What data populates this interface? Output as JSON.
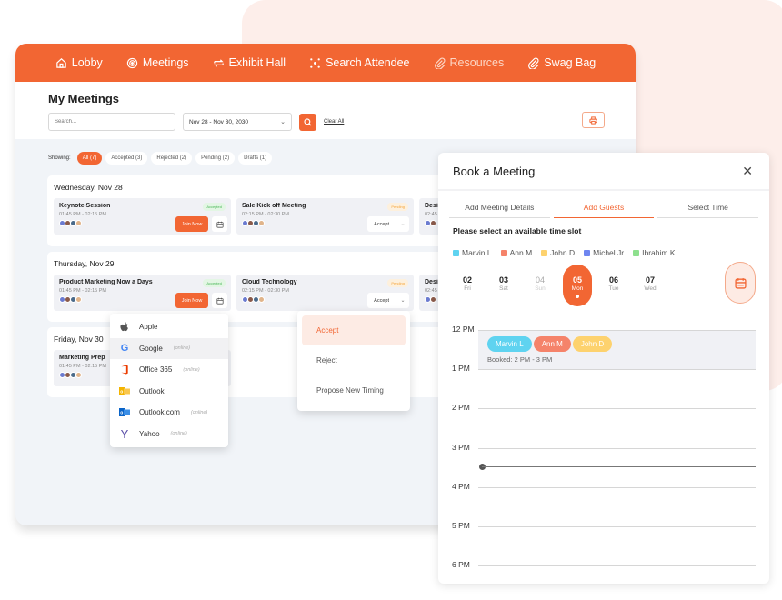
{
  "nav": {
    "items": [
      {
        "label": "Lobby",
        "icon": "home-icon"
      },
      {
        "label": "Meetings",
        "icon": "meetings-icon"
      },
      {
        "label": "Exhibit Hall",
        "icon": "exchange-icon"
      },
      {
        "label": "Search Attendee",
        "icon": "network-icon"
      },
      {
        "label": "Resources",
        "icon": "paperclip-icon"
      },
      {
        "label": "Swag Bag",
        "icon": "paperclip-icon"
      }
    ]
  },
  "meetings": {
    "title": "My Meetings",
    "search_placeholder": "Search...",
    "date_range": "Nov 28 - Nov 30, 2030",
    "clear_all": "Clear All",
    "showing_label": "Showing:",
    "filters": [
      {
        "label": "All (7)",
        "active": true
      },
      {
        "label": "Accepted (3)"
      },
      {
        "label": "Rejected (2)"
      },
      {
        "label": "Pending (2)"
      },
      {
        "label": "Drafts (1)"
      }
    ],
    "days": [
      {
        "title": "Wednesday, Nov 28",
        "cards": [
          {
            "title": "Keynote Session",
            "time": "01:45 PM - 02:15 PM",
            "status": "Accepted",
            "action": "Join Now"
          },
          {
            "title": "Sale Kick off Meeting",
            "time": "02:15 PM - 02:30 PM",
            "status": "Pending",
            "action": "Accept"
          },
          {
            "title": "Desi",
            "time": "02:45"
          }
        ]
      },
      {
        "title": "Thursday, Nov 29",
        "cards": [
          {
            "title": "Product Marketing Now a Days",
            "time": "01:45 PM - 02:15 PM",
            "status": "Accepted",
            "action": "Join Now"
          },
          {
            "title": "Cloud Technology",
            "time": "02:15 PM - 02:30 PM",
            "status": "Pending",
            "action": "Accept"
          },
          {
            "title": "Desi",
            "time": "02:45"
          }
        ]
      },
      {
        "title": "Friday, Nov 30",
        "cards": [
          {
            "title": "Marketing Prep",
            "time": "01:45 PM - 02:15 PM"
          }
        ]
      }
    ]
  },
  "calendar_menu": {
    "items": [
      {
        "label": "Apple",
        "note": ""
      },
      {
        "label": "Google",
        "note": "(online)"
      },
      {
        "label": "Office 365",
        "note": "(online)"
      },
      {
        "label": "Outlook",
        "note": ""
      },
      {
        "label": "Outlook.com",
        "note": "(online)"
      },
      {
        "label": "Yahoo",
        "note": "(online)"
      }
    ]
  },
  "accept_menu": {
    "items": [
      "Accept",
      "Reject",
      "Propose New Timing"
    ]
  },
  "book": {
    "title": "Book a Meeting",
    "tabs": [
      "Add Meeting Details",
      "Add Guests",
      "Select Time"
    ],
    "active_tab": "Add Guests",
    "subtitle": "Please select an available time slot",
    "guests": [
      {
        "name": "Marvin L",
        "color": "#5fd3f0"
      },
      {
        "name": "Ann M",
        "color": "#f5836a"
      },
      {
        "name": "John D",
        "color": "#fdd26e"
      },
      {
        "name": "Michel Jr",
        "color": "#6f86f0"
      },
      {
        "name": "Ibrahim K",
        "color": "#8ee08e"
      }
    ],
    "days": [
      {
        "num": "02",
        "name": "Fri"
      },
      {
        "num": "03",
        "name": "Sat"
      },
      {
        "num": "04",
        "name": "Sun",
        "disabled": true
      },
      {
        "num": "05",
        "name": "Mon",
        "selected": true
      },
      {
        "num": "06",
        "name": "Tue"
      },
      {
        "num": "07",
        "name": "Wed"
      }
    ],
    "hours": [
      "12 PM",
      "1 PM",
      "2 PM",
      "3 PM",
      "4 PM",
      "5 PM",
      "6 PM"
    ],
    "booked": {
      "guests": [
        "Marvin L",
        "Ann M",
        "John D"
      ],
      "text": "Booked: 2 PM - 3 PM"
    }
  },
  "colors": {
    "brand": "#f26633",
    "accepted": "#4cb85a",
    "pending": "#f5a43a"
  }
}
